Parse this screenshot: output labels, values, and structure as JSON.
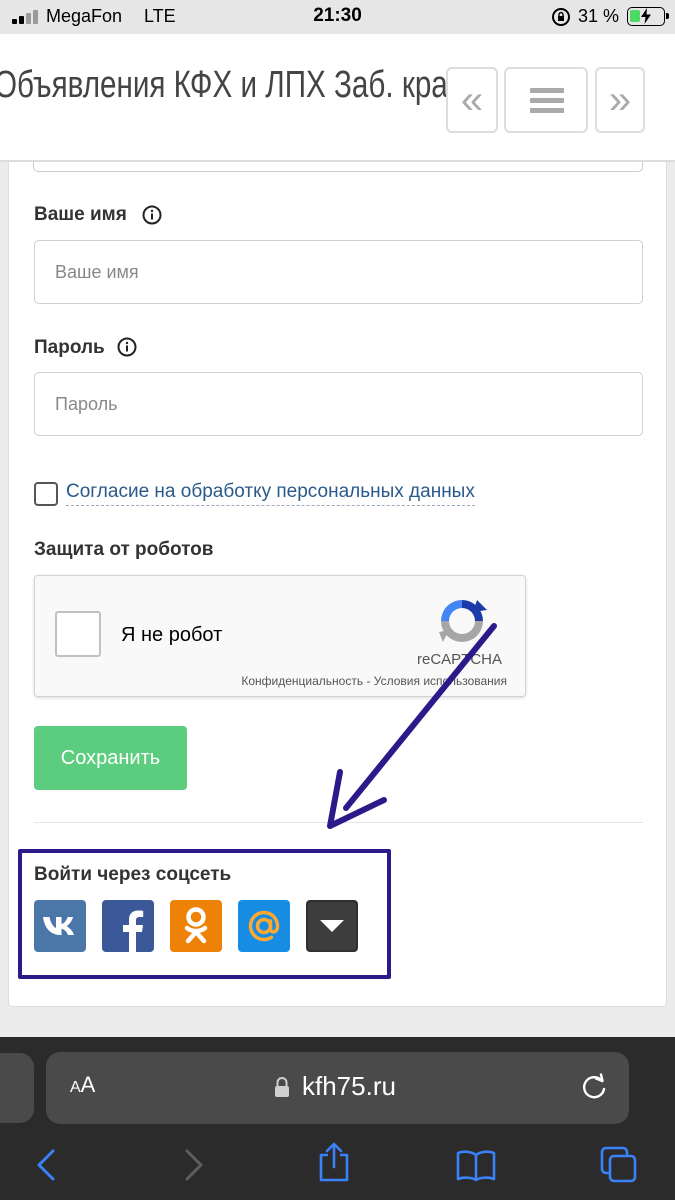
{
  "status_bar": {
    "carrier": "MegaFon",
    "network": "LTE",
    "time": "21:30",
    "battery_percent": "31 %",
    "battery_level": 0.31
  },
  "header": {
    "site_title": "Объявления КФХ и ЛПХ Заб. края",
    "prev_icon": "double-chevron-left-icon",
    "menu_icon": "hamburger-menu-icon",
    "next_icon": "double-chevron-right-icon"
  },
  "form": {
    "name_label": "Ваше имя",
    "name_placeholder": "Ваше имя",
    "name_value": "",
    "password_label": "Пароль",
    "password_placeholder": "Пароль",
    "password_value": "",
    "consent_checked": false,
    "consent_link": "Согласие на обработку персональных данных",
    "robot_label": "Защита от роботов",
    "recaptcha": {
      "checkbox_label": "Я не робот",
      "brand": "reCAPTCHA",
      "privacy": "Конфиденциальность",
      "separator": "-",
      "terms": "Условия использования"
    },
    "save_button": "Сохранить"
  },
  "social": {
    "label": "Войти через соцсеть",
    "buttons": [
      {
        "name": "vk-icon",
        "color": "#4a76a8"
      },
      {
        "name": "facebook-icon",
        "color": "#3b5998"
      },
      {
        "name": "odnoklassniki-icon",
        "color": "#ee8208"
      },
      {
        "name": "mailru-icon",
        "color": "#168de2"
      },
      {
        "name": "more-dropdown-icon",
        "color": "#3d3d3d"
      }
    ]
  },
  "annotation": {
    "box_color": "#2b1a8a",
    "arrow_color": "#2b1a8a"
  },
  "browser": {
    "text_size_button": "AA",
    "url": "kfh75.ru"
  },
  "colors": {
    "save_button": "#5ccc7e",
    "link": "#2a5a8c",
    "browser_bar": "#2b2b2b",
    "browser_icons": "#3a82f7"
  }
}
